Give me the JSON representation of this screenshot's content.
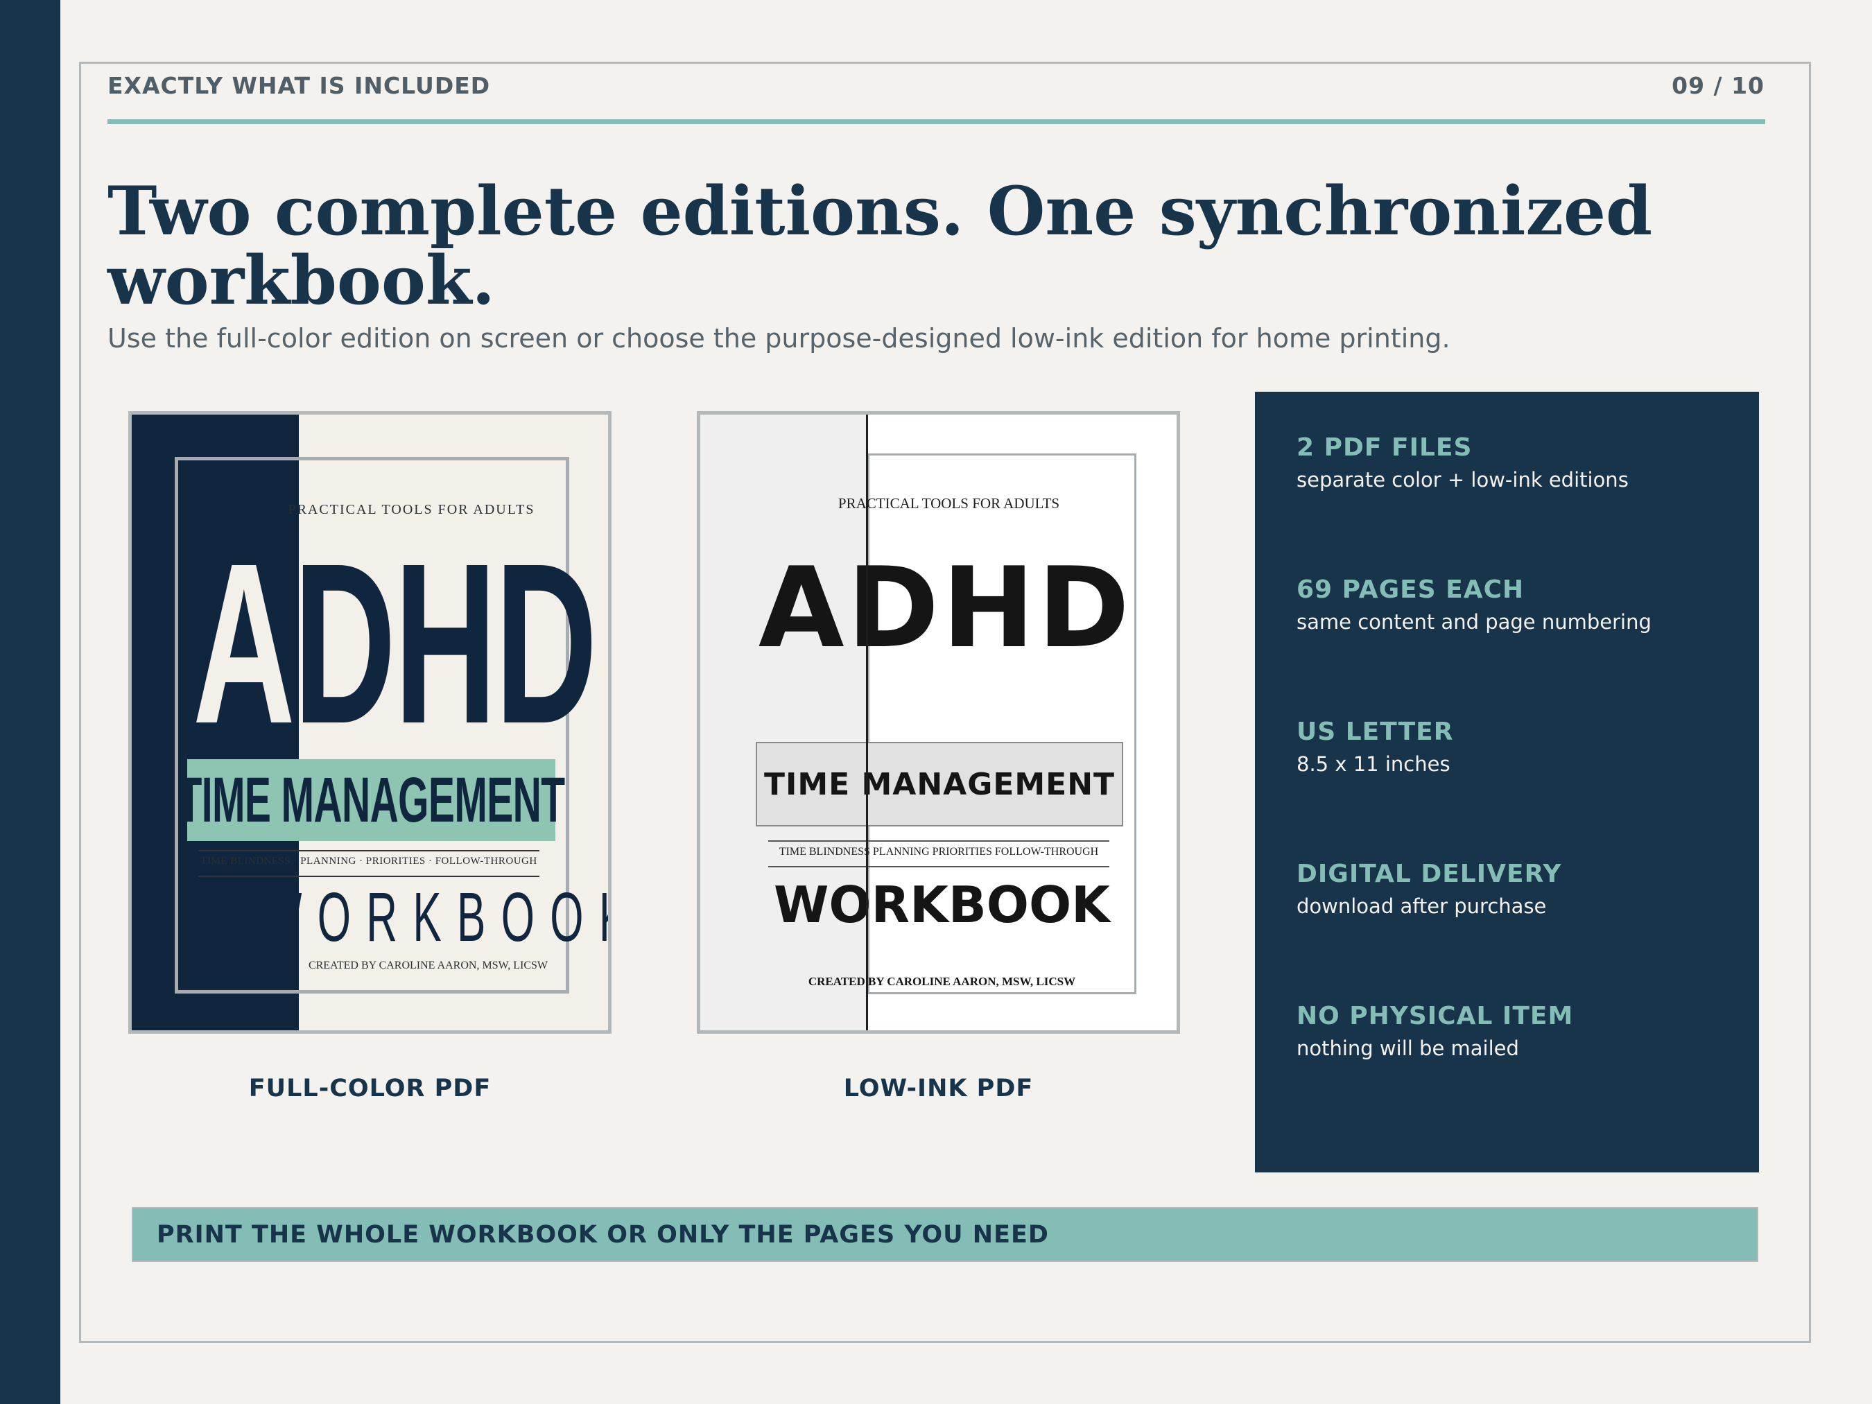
{
  "header": {
    "label": "EXACTLY WHAT IS INCLUDED",
    "page_number": "09 / 10"
  },
  "title": "Two complete editions. One synchronized workbook.",
  "subtitle": "Use the full-color edition on screen or choose the purpose-designed low-ink edition for home printing.",
  "covers": [
    {
      "caption": "FULL-COLOR PDF",
      "art": {
        "tagline": "PRACTICAL TOOLS FOR ADULTS",
        "adhd_a": "A",
        "adhd_rest": "DHD",
        "band": "TIME MANAGEMENT",
        "skills": "TIME BLINDNESS · PLANNING · PRIORITIES · FOLLOW-THROUGH",
        "workbook": "WORKBOOK",
        "author": "CREATED BY CAROLINE AARON, MSW, LICSW"
      }
    },
    {
      "caption": "LOW-INK PDF",
      "art": {
        "tagline": "PRACTICAL TOOLS FOR ADULTS",
        "adhd": "ADHD",
        "band": "TIME MANAGEMENT",
        "skills": "TIME BLINDNESS  PLANNING  PRIORITIES  FOLLOW-THROUGH",
        "workbook": "WORKBOOK",
        "author": "CREATED BY CAROLINE AARON, MSW, LICSW"
      }
    }
  ],
  "specs": [
    {
      "title": "2 PDF FILES",
      "desc": "separate color + low-ink editions"
    },
    {
      "title": "69 PAGES EACH",
      "desc": "same content and page numbering"
    },
    {
      "title": "US LETTER",
      "desc": "8.5 x 11 inches"
    },
    {
      "title": "DIGITAL DELIVERY",
      "desc": "download after purchase"
    },
    {
      "title": "NO PHYSICAL ITEM",
      "desc": "nothing will be mailed"
    }
  ],
  "banner": "PRINT THE WHOLE WORKBOOK OR ONLY THE PAGES YOU NEED",
  "colors": {
    "navy": "#18344a",
    "teal": "#83bdb5",
    "background": "#f4f2ee",
    "muted_text": "#56636b"
  }
}
